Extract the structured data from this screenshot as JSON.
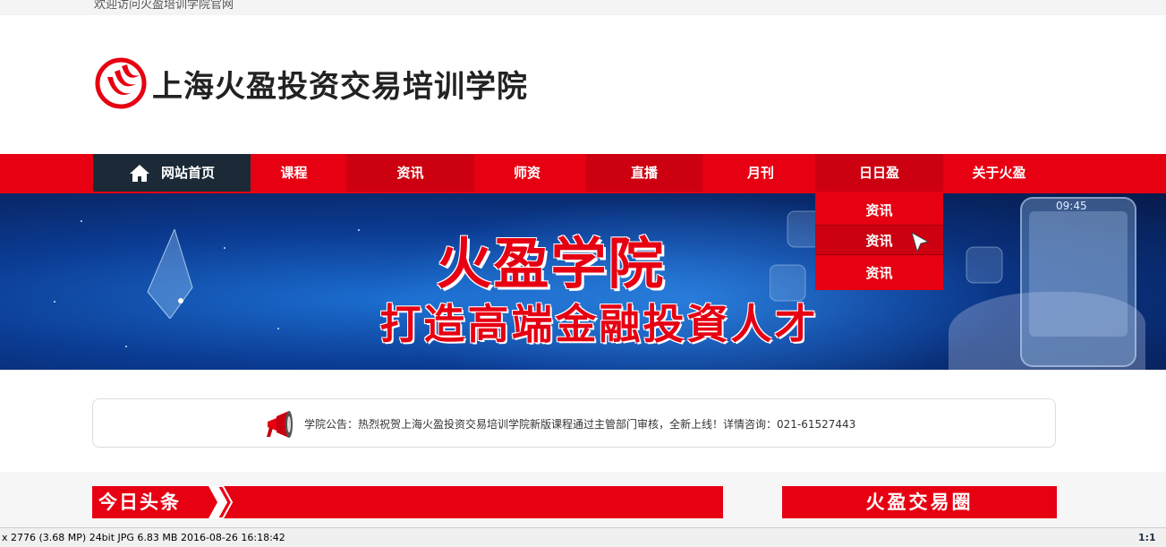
{
  "topbar": {
    "welcome_text": "欢迎访问火盈培训学院官网"
  },
  "logo": {
    "brand_name": "上海火盈投资交易培训学院"
  },
  "nav": {
    "items": [
      {
        "label": "网站首页"
      },
      {
        "label": "课程"
      },
      {
        "label": "资讯"
      },
      {
        "label": "师资"
      },
      {
        "label": "直播"
      },
      {
        "label": "月刊"
      },
      {
        "label": "日日盈"
      },
      {
        "label": "关于火盈"
      }
    ],
    "dropdown": [
      {
        "label": "资讯"
      },
      {
        "label": "资讯"
      },
      {
        "label": "资讯"
      }
    ]
  },
  "banner": {
    "headline": "火盈学院",
    "slogan": "打造高端金融投資人才",
    "device_time": "09:45"
  },
  "notice": {
    "text": "学院公告：热烈祝贺上海火盈投资交易培训学院新版课程通过主管部门审核，全新上线！详情咨询：021-61527443"
  },
  "sections": {
    "left_title": "今日头条",
    "right_title": "火盈交易圈"
  },
  "statusbar": {
    "info": "x 2776 (3.68 MP)  24bit  JPG   6.83 MB   2016-08-26 16:18:42",
    "zoom": "1:1"
  },
  "colors": {
    "brand_red": "#e60012",
    "nav_dark": "#1b2a36"
  }
}
